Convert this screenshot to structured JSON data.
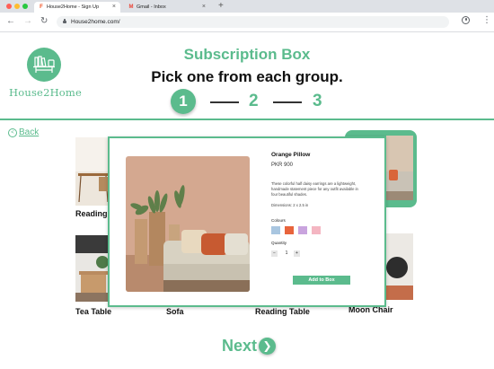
{
  "browser": {
    "tabs": [
      {
        "label": "House2Home - Sign Up",
        "favicon": "figma-icon",
        "close": "×"
      },
      {
        "label": "Gmail - Inbox",
        "favicon": "gmail-icon",
        "close": "×"
      }
    ],
    "new_tab": "+",
    "url": "House2home.com/",
    "nav": {
      "back": "←",
      "forward": "→",
      "reload": "↻",
      "menu": "⋮"
    }
  },
  "brand": {
    "name": "House2Home",
    "color": "#5bbb8d"
  },
  "header": {
    "title": "Subscription Box",
    "subtitle": "Pick one from each group.",
    "steps": [
      "1",
      "2",
      "3"
    ],
    "active_step": "1"
  },
  "back_link": {
    "label": "Back",
    "icon": "chevron-left-icon"
  },
  "items": [
    {
      "label": "Reading Table"
    },
    {
      "label": "Tea Table"
    },
    {
      "label": "Sofa"
    },
    {
      "label": "Reading Table"
    },
    {
      "label": "Moon Chair"
    }
  ],
  "modal": {
    "product_name": "Orange Pillow",
    "price": "PKR 900",
    "description": "These colorful half daisy earrings are a lightweight, handmade statement piece for any outfit available in four beautiful shades.",
    "dimensions": "Dimensions: 2 x 2.5 in",
    "colours_label": "Colours",
    "colours": [
      "#a9c6e0",
      "#e8643c",
      "#c9a4de",
      "#f4b6c2"
    ],
    "quantity_label": "Quantity",
    "quantity": "1",
    "decrement": "−",
    "increment": "+",
    "add_button": "Add to Box"
  },
  "next_button": {
    "label": "Next",
    "icon": "chevron-right-icon"
  }
}
